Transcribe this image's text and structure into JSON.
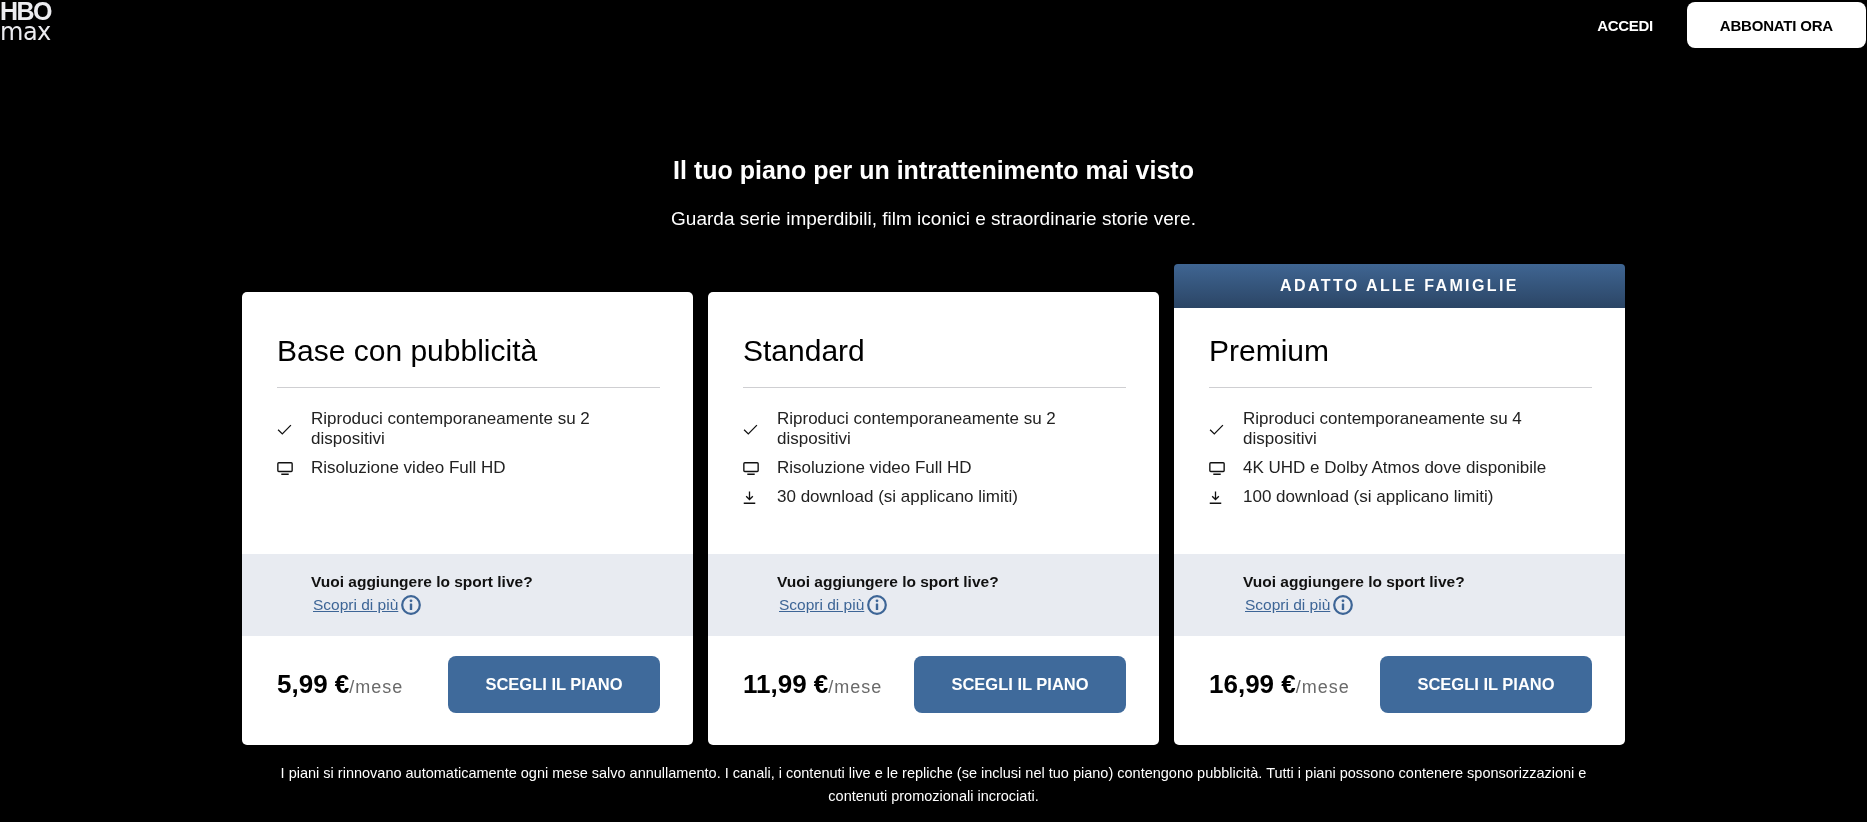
{
  "logo": {
    "line_1": "HBO",
    "line_2": "max"
  },
  "nav": {
    "sign_in": "ACCEDI",
    "subscribe": "ABBONATI ORA"
  },
  "hero": {
    "title": "Il tuo piano per un intrattenimento mai visto",
    "subtitle": "Guarda serie imperdibili, film iconici e straordinarie storie vere."
  },
  "plans": [
    {
      "name": "Base con pubblicità",
      "features": [
        {
          "kind": "check",
          "text": "Riproduci contemporaneamente su 2 dispositivi"
        },
        {
          "kind": "screen",
          "text": "Risoluzione video Full HD"
        }
      ],
      "sport": {
        "question": "Vuoi aggiungere lo sport live?",
        "link": "Scopri di più"
      },
      "price": "5,99 €",
      "period": "/mese",
      "button": "SCEGLI IL PIANO"
    },
    {
      "name": "Standard",
      "features": [
        {
          "kind": "check",
          "text": "Riproduci contemporaneamente su 2 dispositivi"
        },
        {
          "kind": "screen",
          "text": "Risoluzione video Full HD"
        },
        {
          "kind": "download",
          "text": "30 download (si applicano limiti)"
        }
      ],
      "sport": {
        "question": "Vuoi aggiungere lo sport live?",
        "link": "Scopri di più"
      },
      "price": "11,99 €",
      "period": "/mese",
      "button": "SCEGLI IL PIANO"
    },
    {
      "badge": "ADATTO ALLE FAMIGLIE",
      "name": "Premium",
      "features": [
        {
          "kind": "check",
          "text": "Riproduci contemporaneamente su 4 dispositivi"
        },
        {
          "kind": "screen",
          "text": "4K UHD e Dolby Atmos dove disponibile"
        },
        {
          "kind": "download",
          "text": "100 download (si applicano limiti)"
        }
      ],
      "sport": {
        "question": "Vuoi aggiungere lo sport live?",
        "link": "Scopri di più"
      },
      "price": "16,99 €",
      "period": "/mese",
      "button": "SCEGLI IL PIANO"
    }
  ],
  "disclaimer": "I piani si rinnovano automaticamente ogni mese salvo annullamento. I canali, i contenuti live e le repliche (se inclusi nel tuo piano) contengono pubblicità. Tutti i piani possono contenere sponsorizzazioni e contenuti promozionali incrociati."
}
